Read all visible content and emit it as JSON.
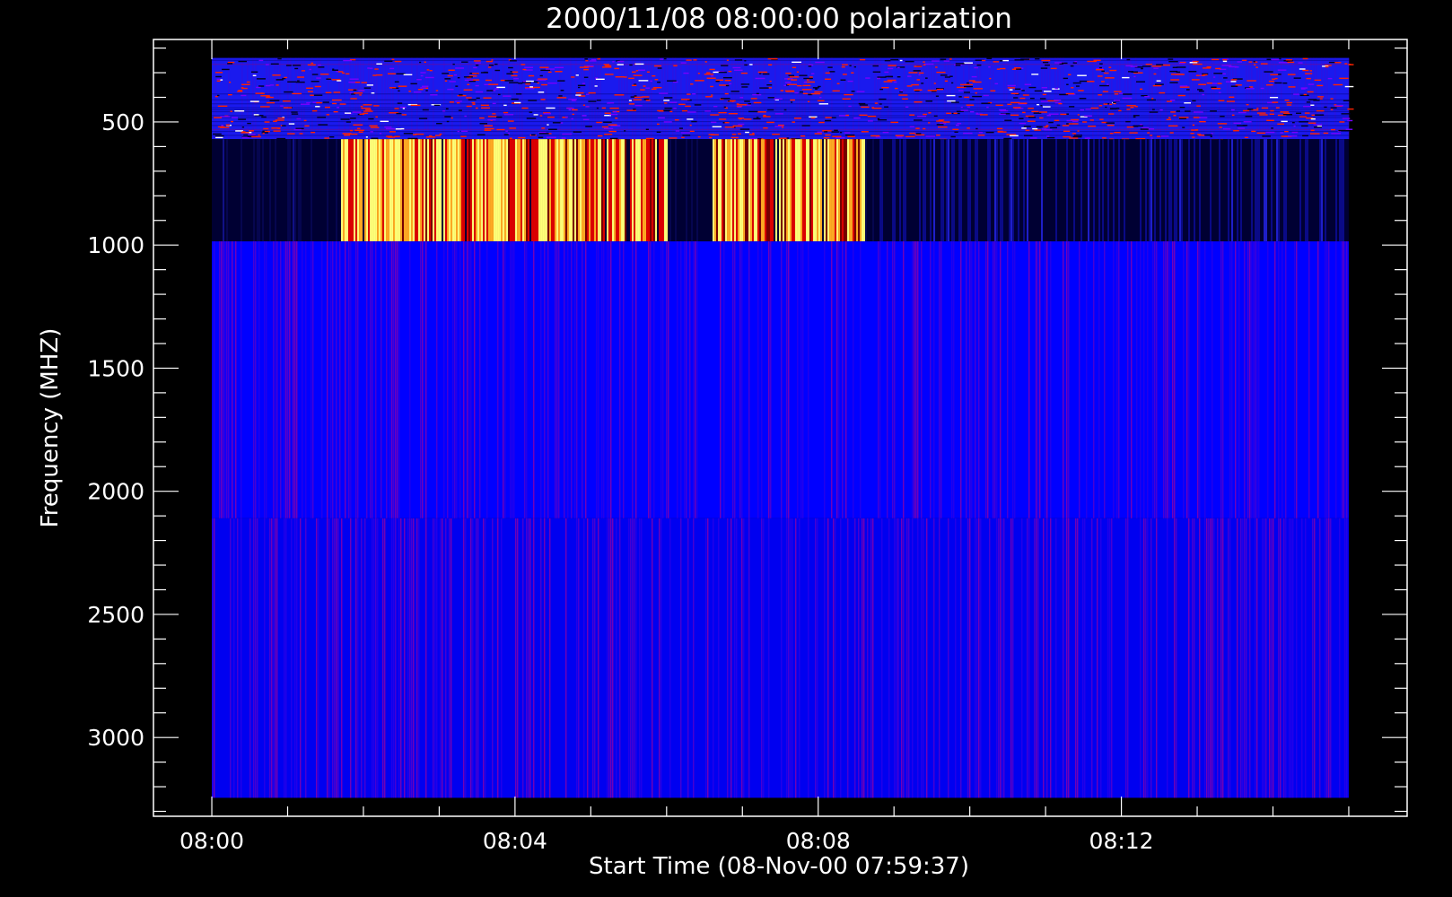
{
  "chart_data": {
    "type": "heatmap",
    "title": "2000/11/08 08:00:00 polarization",
    "xlabel": "Start Time (08-Nov-00 07:59:37)",
    "ylabel": "Frequency (MHZ)",
    "x_ticks": [
      "08:00",
      "08:04",
      "08:08",
      "08:12"
    ],
    "x_tick_minutes": [
      0,
      4,
      8,
      12
    ],
    "x_minor_step_minutes": 1,
    "x_range_minutes": [
      -0.77,
      15.77
    ],
    "y_ticks": [
      "500",
      "1000",
      "1500",
      "2000",
      "2500",
      "3000"
    ],
    "y_tick_values": [
      500,
      1000,
      1500,
      2000,
      2500,
      3000
    ],
    "y_minor_step": 100,
    "y_range": [
      165,
      3320
    ],
    "y_reversed": true,
    "data_time_range_minutes": [
      0,
      15
    ],
    "grid": false,
    "colors": {
      "background": "#000000",
      "foreground": "#ffffff",
      "low": "#0000ff",
      "quiet": "#000033",
      "mid": "#cc0000",
      "high": "#ffff66"
    },
    "bands": [
      {
        "freq_range": [
          240,
          570
        ],
        "pattern": "noise",
        "base": "#1a1aee"
      },
      {
        "freq_range": [
          570,
          985
        ],
        "pattern": "burst",
        "base": "#000033",
        "bursts": [
          {
            "t_range": [
              1.7,
              6.0
            ],
            "intensity": 1.0
          },
          {
            "t_range": [
              6.6,
              8.6
            ],
            "intensity": 0.8
          },
          {
            "t_range": [
              8.8,
              15.0
            ],
            "intensity": 0.15
          }
        ]
      },
      {
        "freq_range": [
          985,
          2110
        ],
        "pattern": "stripes",
        "base": "#0000ff"
      },
      {
        "freq_range": [
          2110,
          3245
        ],
        "pattern": "stripes",
        "base": "#0000f0"
      }
    ]
  }
}
